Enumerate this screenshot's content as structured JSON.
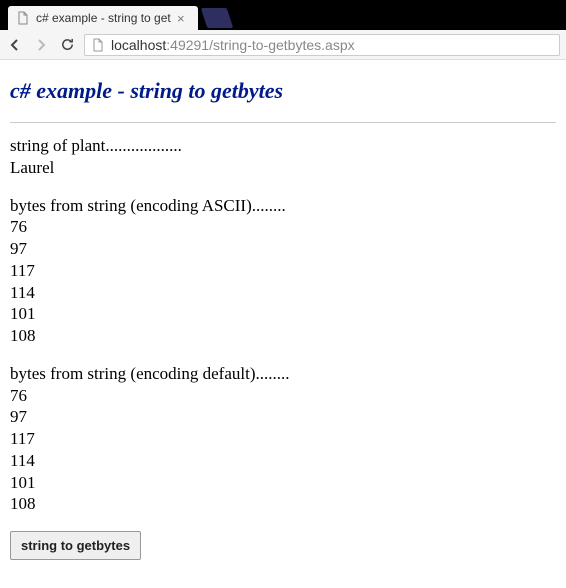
{
  "browser": {
    "tab_title": "c# example - string to getb",
    "address": {
      "host": "localhost",
      "port": ":49291",
      "path": "/string-to-getbytes.aspx"
    }
  },
  "page": {
    "heading": "c# example - string to getbytes",
    "section_plant_label": "string of plant..................",
    "plant_value": "Laurel",
    "section_ascii_label": "bytes from string (encoding ASCII)........",
    "ascii_bytes": [
      "76",
      "97",
      "117",
      "114",
      "101",
      "108"
    ],
    "section_default_label": "bytes from string (encoding default)........",
    "default_bytes": [
      "76",
      "97",
      "117",
      "114",
      "101",
      "108"
    ],
    "button_label": "string to getbytes"
  }
}
